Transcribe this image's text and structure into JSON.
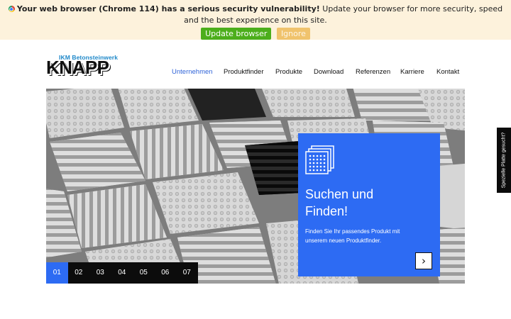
{
  "update_banner": {
    "bold_text": "Your web browser (Chrome 114) has a serious security vulnerability!",
    "text": "Update your browser for more security, speed and the best experience on this site.",
    "update_label": "Update browser",
    "ignore_label": "Ignore"
  },
  "logo": {
    "subtitle": "IKM Betonsteinwerk",
    "name": "KNAPP"
  },
  "nav": {
    "items": [
      {
        "label": "Unternehmen",
        "active": true
      },
      {
        "label": "Produktfinder",
        "active": false
      },
      {
        "label": "Produkte",
        "active": false
      },
      {
        "label": "Download",
        "active": false
      },
      {
        "label": "Referenzen",
        "active": false
      },
      {
        "label": "Karriere",
        "active": false
      },
      {
        "label": "Kontakt",
        "active": false
      }
    ]
  },
  "promo": {
    "title_line1": "Suchen und",
    "title_line2": "Finden!",
    "text_line1": "Finden Sie Ihr passendes Produkt mit",
    "text_line2": "unserem neuen Produktfinder.",
    "arrow_icon": "chevron-right-icon",
    "color": "#2d6bf3"
  },
  "slides": {
    "items": [
      "01",
      "02",
      "03",
      "04",
      "05",
      "06",
      "07"
    ],
    "active_index": 0
  },
  "side_tab": {
    "label": "Spezielle Platte gesucht?"
  },
  "colors": {
    "accent": "#2d6bf3",
    "nav_active": "#2f63d8",
    "banner_bg": "#fdf2dc",
    "update_button": "#4cae1b",
    "ignore_button": "#f0c36d"
  }
}
